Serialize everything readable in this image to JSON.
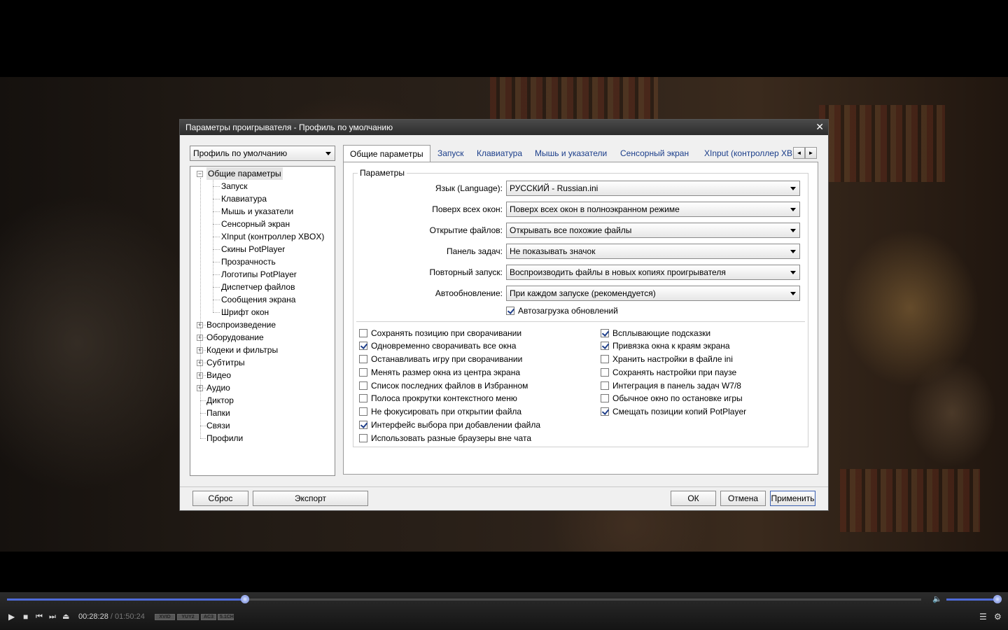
{
  "dialog": {
    "title": "Параметры проигрывателя - Профиль по умолчанию",
    "close_glyph": "✕",
    "profile_select": "Профиль по умолчанию"
  },
  "tree": {
    "root": "Общие параметры",
    "children": [
      "Запуск",
      "Клавиатура",
      "Мышь и указатели",
      "Сенсорный экран",
      "XInput (контроллер XBOX)",
      "Скины PotPlayer",
      "Прозрачность",
      "Логотипы PotPlayer",
      "Диспетчер файлов",
      "Сообщения экрана",
      "Шрифт окон"
    ],
    "collapsed": [
      "Воспроизведение",
      "Оборудование",
      "Кодеки и фильтры",
      "Субтитры",
      "Видео",
      "Аудио"
    ],
    "leaves": [
      "Диктор",
      "Папки",
      "Связи",
      "Профили"
    ]
  },
  "tabs": [
    "Общие параметры",
    "Запуск",
    "Клавиатура",
    "Мышь и указатели",
    "Сенсорный экран",
    "XInput (контроллер XB"
  ],
  "tab_scroll": {
    "left": "◄",
    "right": "►"
  },
  "group": {
    "title": "Параметры",
    "rows": [
      {
        "label": "Язык (Language):",
        "value": "РУССКИЙ - Russian.ini"
      },
      {
        "label": "Поверх всех окон:",
        "value": "Поверх всех окон в полноэкранном режиме"
      },
      {
        "label": "Открытие файлов:",
        "value": "Открывать все похожие файлы"
      },
      {
        "label": "Панель задач:",
        "value": "Не показывать значок"
      },
      {
        "label": "Повторный запуск:",
        "value": "Воспроизводить файлы в новых копиях проигрывателя"
      },
      {
        "label": "Автообновление:",
        "value": "При каждом запуске (рекомендуется)"
      }
    ],
    "autoload": {
      "label": "Автозагрузка обновлений",
      "checked": true
    },
    "left_checks": [
      {
        "label": "Сохранять позицию при сворачивании",
        "checked": false
      },
      {
        "label": "Одновременно сворачивать все окна",
        "checked": true
      },
      {
        "label": "Останавливать игру при сворачивании",
        "checked": false
      },
      {
        "label": "Менять размер окна из центра экрана",
        "checked": false
      },
      {
        "label": "Список последних файлов в Избранном",
        "checked": false
      },
      {
        "label": "Полоса прокрутки контекстного меню",
        "checked": false
      },
      {
        "label": "Не фокусировать при открытии файла",
        "checked": false
      },
      {
        "label": "Интерфейс выбора при добавлении файла",
        "checked": true
      },
      {
        "label": "Использовать разные браузеры вне чата",
        "checked": false
      }
    ],
    "right_checks": [
      {
        "label": "Всплывающие подсказки",
        "checked": true
      },
      {
        "label": "Привязка окна к краям экрана",
        "checked": true
      },
      {
        "label": "Хранить настройки в файле ini",
        "checked": false
      },
      {
        "label": "Сохранять настройки при паузе",
        "checked": false
      },
      {
        "label": "Интеграция в панель задач W7/8",
        "checked": false
      },
      {
        "label": "Обычное окно по остановке игры",
        "checked": false
      },
      {
        "label": "Смещать позиции копий PotPlayer",
        "checked": true
      }
    ]
  },
  "buttons": {
    "reset": "Сброс",
    "export": "Экспорт",
    "ok": "ОК",
    "cancel": "Отмена",
    "apply": "Применить"
  },
  "player": {
    "time_current": "00:28:28",
    "time_separator": " / ",
    "time_total": "01:50:24",
    "progress": 0.26,
    "volume": 0.98,
    "codecs": [
      "XVID",
      "YUY2",
      "AC3",
      "5.1CH"
    ],
    "icons": {
      "play": "▶",
      "stop": "■",
      "prev": "⏮",
      "next": "⏭",
      "eject": "⏏",
      "speaker": "🔈",
      "playlist": "☰",
      "settings": "⚙"
    }
  },
  "colors": {
    "accent": "#4f6bd8",
    "tab_link": "#1a3d8a"
  }
}
